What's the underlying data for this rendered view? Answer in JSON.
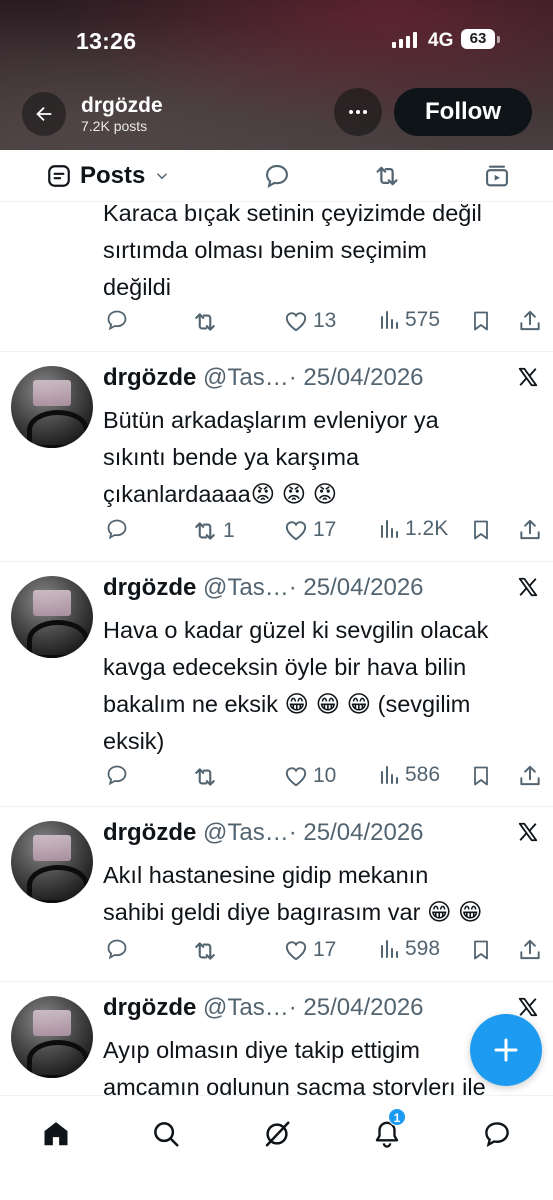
{
  "status_bar": {
    "time": "13:26",
    "network": "4G",
    "battery": "63"
  },
  "profile": {
    "name": "drgözde",
    "post_count": "7.2K posts"
  },
  "header": {
    "follow_label": "Follow"
  },
  "tabs": {
    "posts_label": "Posts"
  },
  "tweets": [
    {
      "text_lines": [
        "Karaca bıçak setinin çeyizimde değil",
        "sırtımda olması benim seçimim",
        "değildi"
      ],
      "retweets": "",
      "likes": "13",
      "views": "575"
    },
    {
      "name": "drgözde",
      "handle": "@Tas…",
      "sep": "·",
      "date": "25/04/2026",
      "text_lines": [
        "Bütün arkadaşlarım evleniyor ya",
        "sıkıntı bende ya karşıma",
        "çıkanlardaaaa😡 😡 😡"
      ],
      "retweets": "1",
      "likes": "17",
      "views": "1.2K"
    },
    {
      "name": "drgözde",
      "handle": "@Tas…",
      "sep": "·",
      "date": "25/04/2026",
      "text_lines": [
        "Hava o kadar güzel ki sevgilin olacak",
        "kavga edeceksin öyle bir hava bilin",
        "bakalım ne eksik 😁 😁 😁  (sevgilim",
        "eksik)"
      ],
      "retweets": "",
      "likes": "10",
      "views": "586"
    },
    {
      "name": "drgözde",
      "handle": "@Tas…",
      "sep": "·",
      "date": "25/04/2026",
      "text_lines": [
        "Akıl hastanesine gidip mekanın",
        "sahibi geldi diye bagırasım var 😁 😁"
      ],
      "retweets": "",
      "likes": "17",
      "views": "598"
    },
    {
      "name": "drgözde",
      "handle": "@Tas…",
      "sep": "·",
      "date": "25/04/2026",
      "text_lines": [
        "Ayıp olmasın diye takip ettigim",
        "amcamın oglunun saçma storylerı ile"
      ]
    }
  ],
  "bottom_nav": {
    "notifications_badge": "1"
  },
  "colors": {
    "accent": "#1d9bf0",
    "text": "#0f1419",
    "muted": "#536471",
    "divider": "#eff3f4"
  },
  "icons": [
    "back-arrow-icon",
    "more-icon",
    "posts-icon",
    "chevron-down-icon",
    "reply-icon",
    "retweet-icon",
    "like-icon",
    "views-icon",
    "bookmark-icon",
    "share-icon",
    "x-logo-icon",
    "plus-icon",
    "home-icon",
    "search-icon",
    "grok-icon",
    "bell-icon",
    "messages-icon"
  ]
}
